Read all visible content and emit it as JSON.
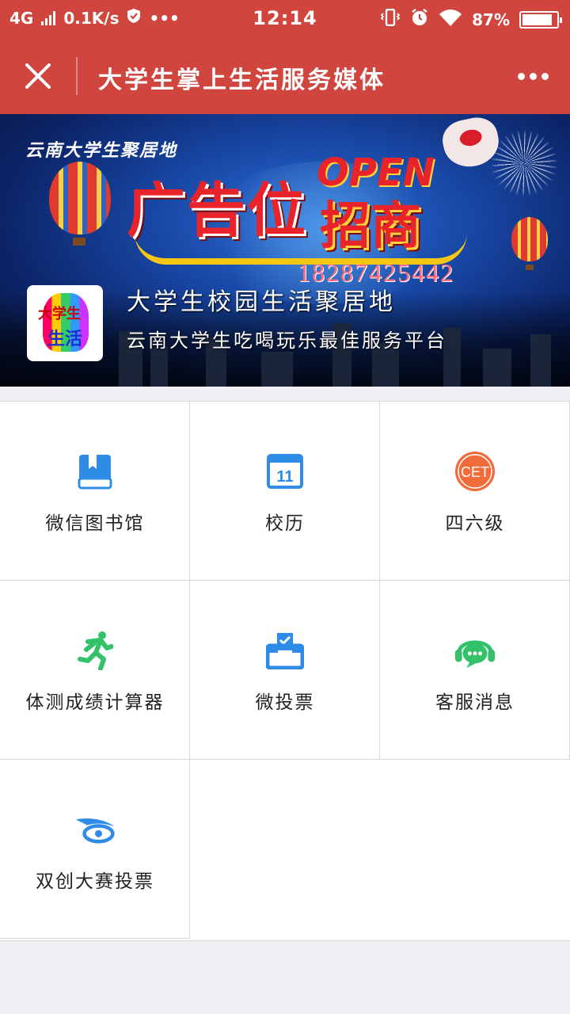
{
  "status_bar": {
    "network": "4G",
    "speed": "0.1K/s",
    "more": "•••",
    "time": "12:14",
    "battery": "87%",
    "battery_level": 0.87
  },
  "nav": {
    "title": "大学生掌上生活服务媒体",
    "close_icon": "close-icon",
    "more_icon": "more-dots-icon"
  },
  "banner": {
    "caption": "云南大学生聚居地",
    "ad_main": "广告位",
    "ad_open": "OPEN",
    "ad_zhaoshang": "招商",
    "phone": "18287425442",
    "logo_line1": "大学生",
    "logo_line2": "生活",
    "title": "大学生校园生活聚居地",
    "subtitle": "云南大学生吃喝玩乐最佳服务平台"
  },
  "grid": {
    "items": [
      {
        "label": "微信图书馆",
        "icon": "book-icon",
        "color": "#2e8be6"
      },
      {
        "label": "校历",
        "icon": "calendar-icon",
        "color": "#2e8be6",
        "icon_text": "11"
      },
      {
        "label": "四六级",
        "icon": "cet-icon",
        "color": "#f26b3a",
        "icon_text": "CET"
      },
      {
        "label": "体测成绩计算器",
        "icon": "running-icon",
        "color": "#33c16a"
      },
      {
        "label": "微投票",
        "icon": "ballot-box-icon",
        "color": "#2e8be6"
      },
      {
        "label": "客服消息",
        "icon": "headset-chat-icon",
        "color": "#33c16a"
      },
      {
        "label": "双创大赛投票",
        "icon": "swoosh-logo-icon",
        "color": "#2e8be6"
      }
    ]
  }
}
